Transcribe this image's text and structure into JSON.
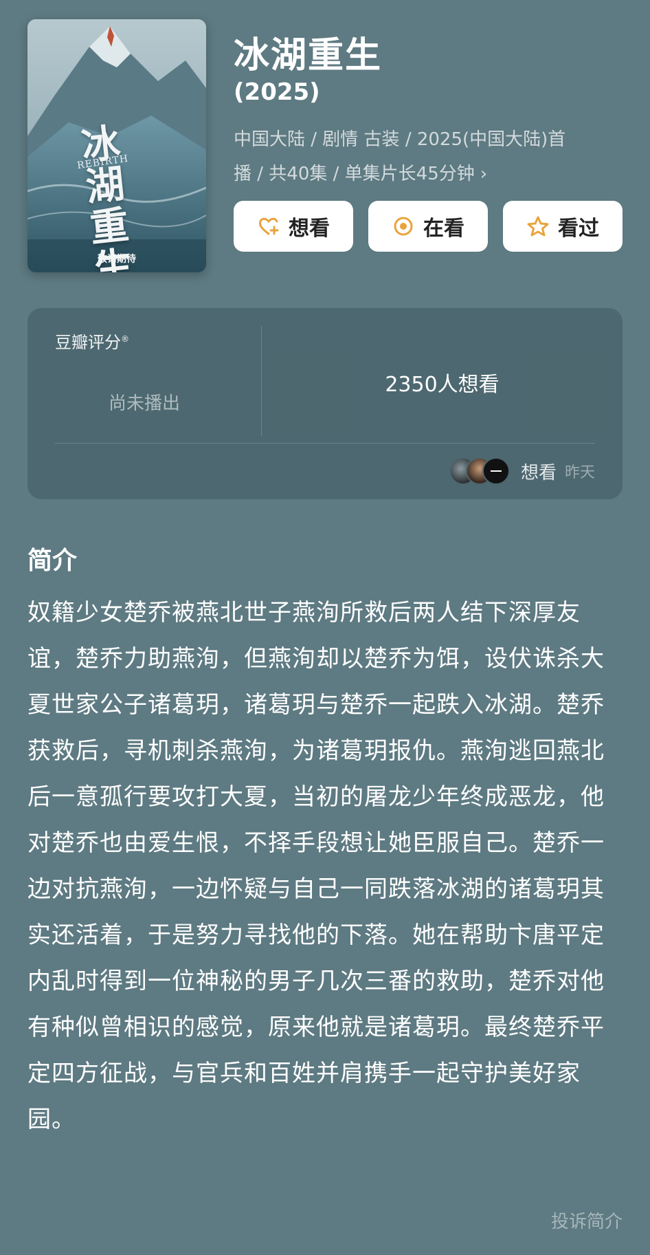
{
  "poster": {
    "title_cn": "冰湖重生",
    "title_en": "REBIRTH",
    "tagline": "敬请期待"
  },
  "header": {
    "title": "冰湖重生",
    "year": "(2025)",
    "meta_line1": "中国大陆 / 剧情 古装 / 2025(中国大陆)首",
    "meta_line2": "播 / 共40集 / 单集片长45分钟",
    "meta_chevron": "›"
  },
  "actions": [
    {
      "label": "想看",
      "icon": "heart-plus-icon"
    },
    {
      "label": "在看",
      "icon": "target-circle-icon"
    },
    {
      "label": "看过",
      "icon": "star-outline-icon"
    }
  ],
  "rating": {
    "label": "豆瓣评分",
    "registered_mark": "®",
    "status": "尚未播出",
    "want_count": "2350人想看",
    "activity_label": "想看",
    "activity_time": "昨天"
  },
  "synopsis": {
    "title": "简介",
    "text": "奴籍少女楚乔被燕北世子燕洵所救后两人结下深厚友谊，楚乔力助燕洵，但燕洵却以楚乔为饵，设伏诛杀大夏世家公子诸葛玥，诸葛玥与楚乔一起跌入冰湖。楚乔获救后，寻机刺杀燕洵，为诸葛玥报仇。燕洵逃回燕北后一意孤行要攻打大夏，当初的屠龙少年终成恶龙，他对楚乔也由爱生恨，不择手段想让她臣服自己。楚乔一边对抗燕洵，一边怀疑与自己一同跌落冰湖的诸葛玥其实还活着，于是努力寻找他的下落。她在帮助卞唐平定内乱时得到一位神秘的男子几次三番的救助，楚乔对他有种似曾相识的感觉，原来他就是诸葛玥。最终楚乔平定四方征战，与官兵和百姓并肩携手一起守护美好家园。",
    "report_label": "投诉简介"
  },
  "colors": {
    "background": "#5e7a82",
    "accent": "#e8a33c",
    "button_bg": "#ffffff"
  }
}
